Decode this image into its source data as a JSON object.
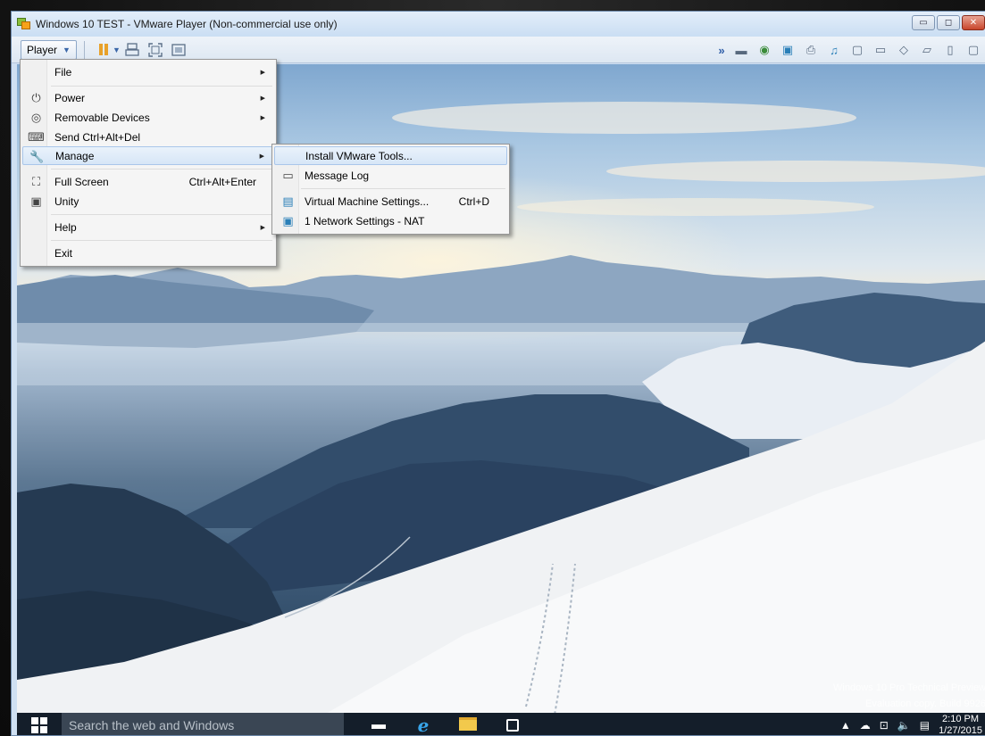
{
  "window": {
    "title": "Windows 10 TEST - VMware Player (Non-commercial use only)"
  },
  "toolbar": {
    "player_label": "Player"
  },
  "player_menu": {
    "items": [
      {
        "label": "File",
        "icon": "none",
        "has_submenu": true
      },
      {
        "label": "Power",
        "icon": "power-icon",
        "has_submenu": true
      },
      {
        "label": "Removable Devices",
        "icon": "removable-devices-icon",
        "has_submenu": true
      },
      {
        "label": "Send Ctrl+Alt+Del",
        "icon": "keyboard-icon",
        "has_submenu": false
      },
      {
        "label": "Manage",
        "icon": "wrench-icon",
        "has_submenu": true,
        "selected": true
      },
      {
        "label": "Full Screen",
        "icon": "fullscreen-icon",
        "shortcut": "Ctrl+Alt+Enter"
      },
      {
        "label": "Unity",
        "icon": "unity-icon"
      },
      {
        "label": "Help",
        "icon": "none",
        "has_submenu": true
      },
      {
        "label": "Exit",
        "icon": "none"
      }
    ]
  },
  "manage_submenu": {
    "items": [
      {
        "label": "Install VMware Tools...",
        "icon": "none",
        "selected": true
      },
      {
        "label": "Message Log",
        "icon": "message-log-icon"
      },
      {
        "label": "Virtual Machine Settings...",
        "icon": "vm-settings-icon",
        "shortcut": "Ctrl+D"
      },
      {
        "label": "1  Network Settings - NAT",
        "icon": "network-icon"
      }
    ]
  },
  "desktop": {
    "watermark_line1": "Windows 10 Pro Technical Preview",
    "watermark_line2": "Evaluation copy. Build 9926"
  },
  "taskbar": {
    "search_placeholder": "Search the web and Windows",
    "time": "2:10 PM",
    "date": "1/27/2015"
  },
  "colors": {
    "taskbar": "#141e2a",
    "search_box": "#3a4654",
    "menu_selection": "#d7e6f7",
    "titlebar": "#cadef3"
  }
}
